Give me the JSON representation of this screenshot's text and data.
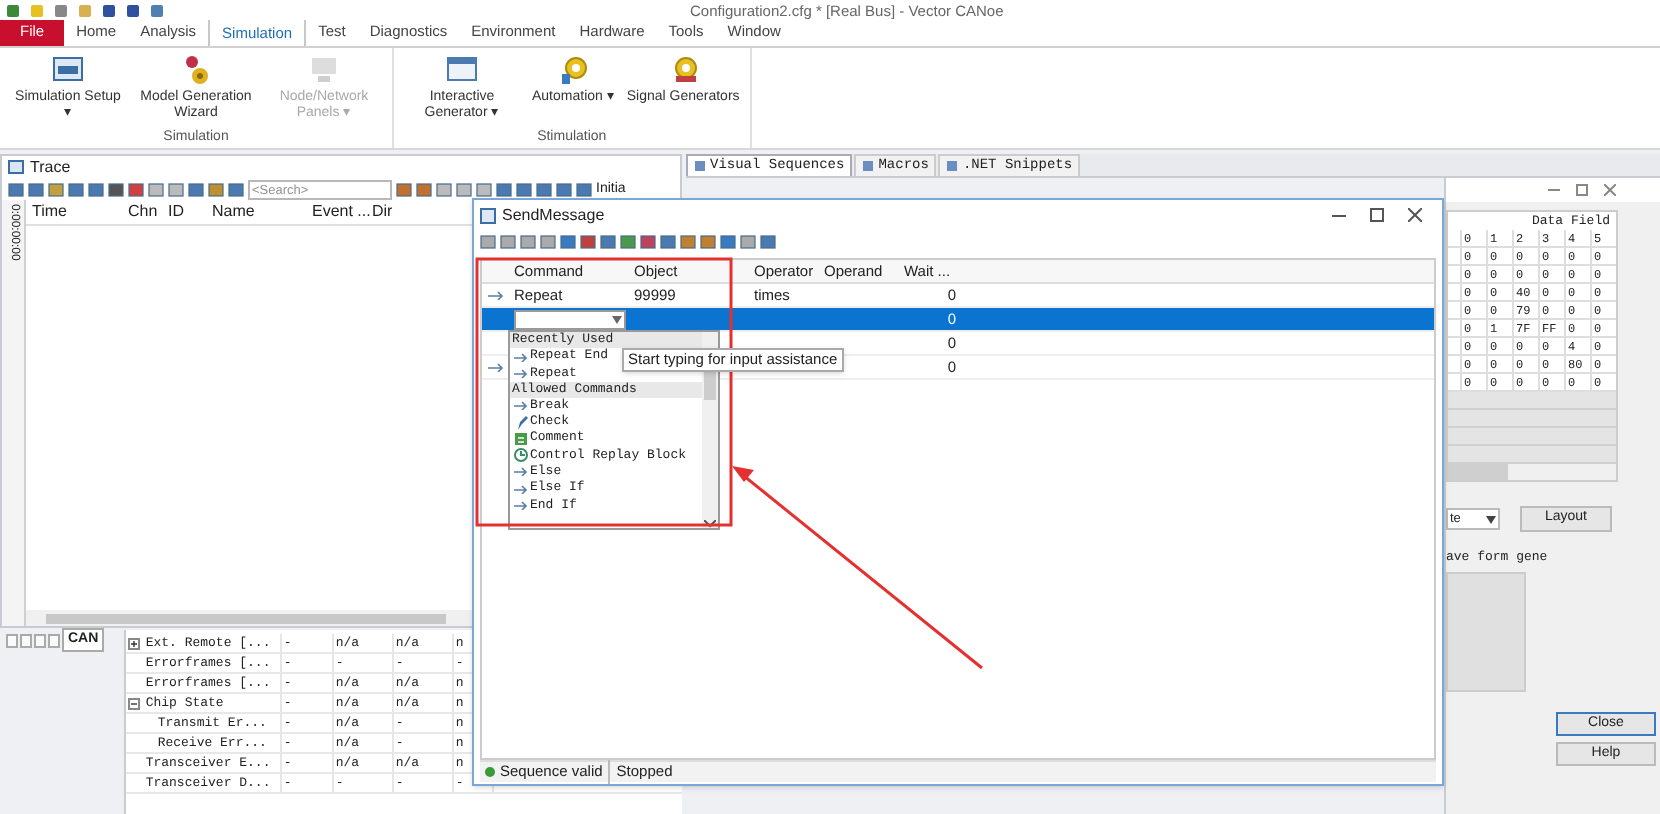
{
  "window": {
    "title": "Configuration2.cfg * [Real Bus] - Vector CANoe"
  },
  "ribbon_tabs": [
    {
      "label": "File",
      "selected": false,
      "kind": "file"
    },
    {
      "label": "Home",
      "selected": false,
      "kind": "tab"
    },
    {
      "label": "Analysis",
      "selected": false,
      "kind": "tab"
    },
    {
      "label": "Simulation",
      "selected": true,
      "kind": "tab"
    },
    {
      "label": "Test",
      "selected": false,
      "kind": "tab"
    },
    {
      "label": "Diagnostics",
      "selected": false,
      "kind": "tab"
    },
    {
      "label": "Environment",
      "selected": false,
      "kind": "tab"
    },
    {
      "label": "Hardware",
      "selected": false,
      "kind": "tab"
    },
    {
      "label": "Tools",
      "selected": false,
      "kind": "tab"
    },
    {
      "label": "Window",
      "selected": false,
      "kind": "tab"
    }
  ],
  "ribbon_groups": [
    {
      "label": "Simulation",
      "buttons": [
        {
          "label": "Simulation Setup ▾",
          "disabled": false
        },
        {
          "label": "Model Generation Wizard",
          "disabled": false
        },
        {
          "label": "Node/Network Panels ▾",
          "disabled": true
        }
      ]
    },
    {
      "label": "Stimulation",
      "buttons": [
        {
          "label": "Interactive Generator ▾",
          "disabled": false
        },
        {
          "label": "Automation ▾",
          "disabled": false
        },
        {
          "label": "Signal Generators",
          "disabled": false
        }
      ]
    }
  ],
  "trace": {
    "title": "Trace",
    "search": {
      "placeholder": "<Search>"
    },
    "toolbar_text": "Initia",
    "ruler_text": "0:00:00:00",
    "columns": [
      "Time",
      "Chn",
      "ID",
      "Name",
      "Event ...",
      "Dir"
    ]
  },
  "statistics": {
    "tab": "CAN",
    "rows": [
      {
        "cells": [
          "Ext. Remote [...",
          "-",
          "n/a",
          "n/a",
          "n"
        ],
        "expanded": false
      },
      {
        "cells": [
          "Errorframes [...",
          "-",
          "-",
          "-",
          "-"
        ]
      },
      {
        "cells": [
          "Errorframes [...",
          "-",
          "n/a",
          "n/a",
          "n"
        ]
      },
      {
        "cells": [
          "Chip State",
          "-",
          "n/a",
          "n/a",
          "n"
        ],
        "expanded": true,
        "children": [
          {
            "cells": [
              "Transmit Er...",
              "-",
              "n/a",
              "-",
              "n"
            ]
          },
          {
            "cells": [
              "Receive Err...",
              "-",
              "n/a",
              "-",
              "n"
            ]
          }
        ]
      },
      {
        "cells": [
          "Transceiver E...",
          "-",
          "n/a",
          "n/a",
          "n"
        ]
      },
      {
        "cells": [
          "Transceiver D...",
          "-",
          "-",
          "-",
          "-"
        ]
      }
    ]
  },
  "side_tabs": [
    {
      "label": "Visual Sequences",
      "selected": true
    },
    {
      "label": "Macros",
      "selected": false
    },
    {
      "label": ".NET Snippets",
      "selected": false
    }
  ],
  "data_panel": {
    "heading": "Data Field",
    "columns": [
      "0",
      "1",
      "2",
      "3",
      "4",
      "5"
    ],
    "rows": [
      [
        "0",
        "0",
        "0",
        "0",
        "0",
        "0"
      ],
      [
        "0",
        "0",
        "0",
        "0",
        "0",
        "0"
      ],
      [
        "0",
        "0",
        "40",
        "0",
        "0",
        "0"
      ],
      [
        "0",
        "0",
        "79",
        "0",
        "0",
        "0"
      ],
      [
        "0",
        "1",
        "7F",
        "FF",
        "0",
        "0"
      ],
      [
        "0",
        "0",
        "0",
        "0",
        "4",
        "0"
      ],
      [
        "0",
        "0",
        "0",
        "0",
        "80",
        "0"
      ],
      [
        "0",
        "0",
        "0",
        "0",
        "0",
        "0"
      ]
    ],
    "dropdown_text": "te",
    "layout_button": "Layout",
    "wave_text": "ave form gene",
    "close_button": "Close",
    "help_button": "Help"
  },
  "send_message": {
    "title": "SendMessage",
    "columns": [
      "Command",
      "Object",
      "Operator",
      "Operand",
      "Wait ..."
    ],
    "rows": [
      {
        "command": "Repeat",
        "object": "99999",
        "operator": "times",
        "wait": "0",
        "selected": false,
        "icon": true
      },
      {
        "wait": "0",
        "selected": true,
        "icon": false
      },
      {
        "wait": "0",
        "selected": false,
        "icon": false
      },
      {
        "wait": "0",
        "selected": false,
        "icon": true
      }
    ],
    "dropdown": {
      "sections": [
        {
          "label": "Recently Used",
          "items": [
            {
              "label": "Repeat End",
              "kind": "command"
            },
            {
              "label": "Repeat",
              "kind": "command"
            }
          ]
        },
        {
          "label": "Allowed Commands",
          "items": [
            {
              "label": "Break",
              "kind": "command"
            },
            {
              "label": "Check",
              "kind": "check"
            },
            {
              "label": "Comment",
              "kind": "comment"
            },
            {
              "label": "Control Replay Block",
              "kind": "replay"
            },
            {
              "label": "Else",
              "kind": "command"
            },
            {
              "label": "Else If",
              "kind": "command"
            },
            {
              "label": "End If",
              "kind": "command"
            }
          ]
        }
      ]
    },
    "tooltip": "Start typing for input assistance",
    "status": [
      "Sequence valid",
      "Stopped"
    ]
  }
}
